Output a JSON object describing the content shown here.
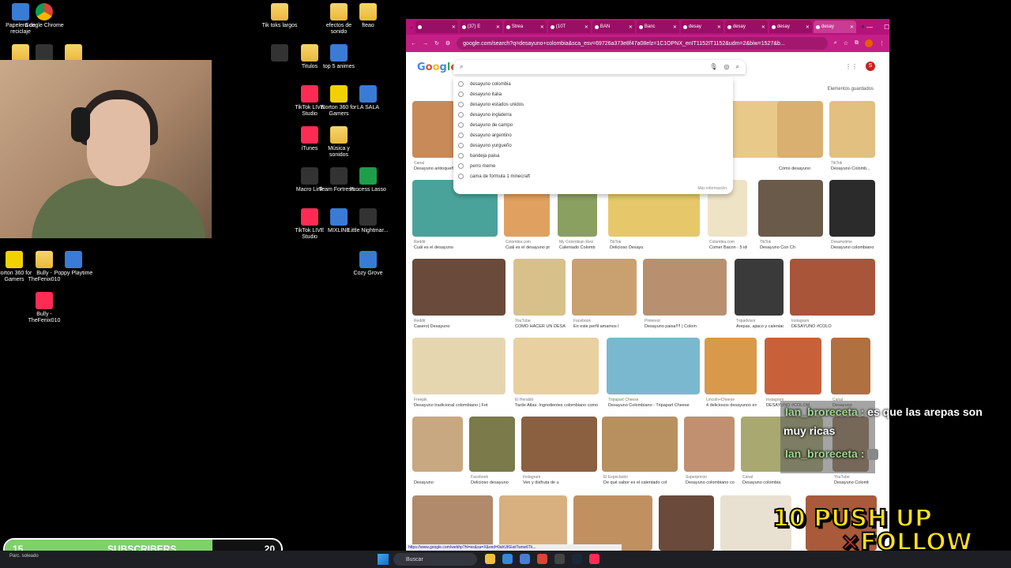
{
  "desktop": {
    "icons": [
      {
        "label": "Papelera de reciclaje",
        "icon": "recycle-bin-icon",
        "kind": "app-blue"
      },
      {
        "label": "Google Chrome",
        "icon": "chrome-icon",
        "kind": "app-chrome"
      },
      {
        "label": "Tik toks largos",
        "icon": "folder-icon",
        "kind": "folder"
      },
      {
        "label": "efectos de sonido",
        "icon": "folder-icon",
        "kind": "folder"
      },
      {
        "label": "fteao",
        "icon": "folder-icon",
        "kind": "folder"
      },
      {
        "label": "Titulos",
        "icon": "folder-icon",
        "kind": "folder"
      },
      {
        "label": "top 5 animes",
        "icon": "document-icon",
        "kind": "app-blue"
      },
      {
        "label": "TikTok LIVE Studio",
        "icon": "tiktok-icon",
        "kind": "app-tiktok"
      },
      {
        "label": "Norton 360 for Gamers",
        "icon": "norton-icon",
        "kind": "app-norton"
      },
      {
        "label": "LA SALA",
        "icon": "document-icon",
        "kind": "app-blue"
      },
      {
        "label": "iTunes",
        "icon": "itunes-icon",
        "kind": "app-tiktok"
      },
      {
        "label": "Música y sonidos",
        "icon": "folder-icon",
        "kind": "folder"
      },
      {
        "label": "Macro Link",
        "icon": "macro-link-icon",
        "kind": "app-dark"
      },
      {
        "label": "Team Fortress...",
        "icon": "team-fortress-icon",
        "kind": "app-dark"
      },
      {
        "label": "Process Lasso",
        "icon": "process-lasso-icon",
        "kind": "app-green"
      },
      {
        "label": "TikTok LIVE Studio",
        "icon": "tiktok-icon",
        "kind": "app-tiktok"
      },
      {
        "label": "MIXLINE",
        "icon": "mixline-icon",
        "kind": "app-blue"
      },
      {
        "label": "Little Nightmar...",
        "icon": "little-nightmares-icon",
        "kind": "app-dark"
      },
      {
        "label": "Cozy Grove",
        "icon": "cozy-grove-icon",
        "kind": "app-blue"
      },
      {
        "label": "Norton 360 for Gamers",
        "icon": "norton-icon",
        "kind": "app-norton"
      },
      {
        "label": "Bully - TheFenix010",
        "icon": "folder-icon",
        "kind": "folder"
      },
      {
        "label": "Poppy Playtime",
        "icon": "poppy-playtime-icon",
        "kind": "app-blue"
      },
      {
        "label": "Bully - TheFenix010",
        "icon": "winrar-icon",
        "kind": "app-tiktok"
      }
    ]
  },
  "browser": {
    "tabs": [
      {
        "label": "",
        "active": false
      },
      {
        "label": "(37) E",
        "active": false
      },
      {
        "label": "Strea",
        "active": false
      },
      {
        "label": "(10T",
        "active": false
      },
      {
        "label": "BAN",
        "active": false
      },
      {
        "label": "Banc",
        "active": false
      },
      {
        "label": "desay",
        "active": false
      },
      {
        "label": "desay",
        "active": false
      },
      {
        "label": "desay",
        "active": false
      },
      {
        "label": "desay",
        "active": true
      }
    ],
    "url": "google.com/search?q=desayuno+colombia&sca_esv=69726a373e8f47a08elz=1C1OPNX_enIT1152IT1152&udm=2&biw=1527&b...",
    "status_url": "https://www.google.com/webhp?hl=es&sa=X&ved=0ahUKEwiTwnw6Tk..."
  },
  "google": {
    "logo": [
      "G",
      "o",
      "o",
      "g",
      "l",
      "e"
    ],
    "search_placeholder": "",
    "suggestions": [
      "desayuno colombia",
      "desayuno italia",
      "desayuno estados unidos",
      "desayuno inglaterra",
      "desayuno de campo",
      "desayuno argentino",
      "desayuno yurgueño",
      "bandeja paisa",
      "perro meme",
      "cama de formula 1 minecraft"
    ],
    "more_info": "Más información",
    "safe_search": "Elementos guardados",
    "account_initial": "S",
    "results": [
      {
        "source": "Canal",
        "caption": "Desayuno antioqueño",
        "color": "#c98a5a"
      },
      {
        "source": "",
        "caption": "",
        "color": "#e8c98a"
      },
      {
        "source": "",
        "caption": "Cómo desayuno",
        "color": "#d9b070"
      },
      {
        "source": "TikTok",
        "caption": "Desayuno Colomb...",
        "color": "#e1c080"
      },
      {
        "source": "Reddit",
        "caption": "Cuál es el desayuno",
        "color": "#4aa39a"
      },
      {
        "source": "Colombia.com",
        "caption": "Cuál es el desayuno preferido por los",
        "color": "#e0a060"
      },
      {
        "source": "My Colombian Reci",
        "caption": "Calentado Colomb",
        "color": "#8aa060"
      },
      {
        "source": "TikTok",
        "caption": "Delicioso Desayu",
        "color": "#e6c86a"
      },
      {
        "source": "Colombia.com",
        "caption": "Comer Bacon · 5 ideas de arepas colombia",
        "color": "#efe3c6"
      },
      {
        "source": "TikTok",
        "caption": "Desayuno Con Ch",
        "color": "#6a5a4a"
      },
      {
        "source": "Dreamstime",
        "caption": "Desayuno colombiano típico",
        "color": "#2b2b2b"
      },
      {
        "source": "Reddit",
        "caption": "Casero| Desayuno",
        "color": "#6a4a3a"
      },
      {
        "source": "YouTube",
        "caption": "CÓMO HACER UN DESAYUNO TÍPICO C",
        "color": "#d8c08a"
      },
      {
        "source": "Facebook",
        "caption": "En este perfil amamos l",
        "color": "#c9a070"
      },
      {
        "source": "Pinterest",
        "caption": "Desayuno paisa!!!! | Colom",
        "color": "#b89070"
      },
      {
        "source": "Tripadvisor",
        "caption": "Arepas, ajiaco y calentado: los mejores",
        "color": "#3a3a3a"
      },
      {
        "source": "Instagram",
        "caption": "DESAYUNO #COLO",
        "color": "#a8553a"
      },
      {
        "source": "Freepik",
        "caption": "Desayuno tradicional colombiano | Fot",
        "color": "#e6d6b0"
      },
      {
        "source": "El Heraldo",
        "caption": "Tarde Atlas: Ingredientes colombiano como un",
        "color": "#e8d0a0"
      },
      {
        "source": "Tripapart Cheese",
        "caption": "Desayuno Colombiano - Tripapart Cheese",
        "color": "#7ab8d0"
      },
      {
        "source": "Lincoln+Cheese",
        "caption": "4 deliciosos desayunos en Colombia Lincoln",
        "color": "#d89a4a"
      },
      {
        "source": "Instagram",
        "caption": "DESAYUNO #COLOM",
        "color": "#c8603a"
      },
      {
        "source": "Canal",
        "caption": "Desayuno",
        "color": "#b07040"
      },
      {
        "source": "",
        "caption": "Desayuno",
        "color": "#c8a880"
      },
      {
        "source": "Facebook",
        "caption": "Delicioso desayuno",
        "color": "#7a7a4a"
      },
      {
        "source": "Instagram",
        "caption": "Ven y disfruta de u",
        "color": "#8a6040"
      },
      {
        "source": "El Espectador",
        "caption": "De qué sabor es el calentado col",
        "color": "#b89060"
      },
      {
        "source": "Superprecio",
        "caption": "Desayuno colombiano completo",
        "color": "#c09070"
      },
      {
        "source": "Canal",
        "caption": "Desayuno colombia",
        "color": "#a8a870"
      },
      {
        "source": "YouTube",
        "caption": "Desayuno Colombiano, AREPAS REL",
        "color": "#9a7a5a"
      },
      {
        "source": "Instagram",
        "caption": "No hay desayuno",
        "color": "#b08a6a"
      },
      {
        "source": "",
        "caption": "",
        "color": "#d8b080"
      },
      {
        "source": "",
        "caption": "",
        "color": "#c09060"
      },
      {
        "source": "",
        "caption": "",
        "color": "#6a4a3a"
      },
      {
        "source": "",
        "caption": "",
        "color": "#e8e0d0"
      },
      {
        "source": "",
        "caption": "",
        "color": "#a85a3a"
      },
      {
        "source": "",
        "caption": "",
        "color": "#d0a070"
      }
    ]
  },
  "chat": {
    "lines": [
      {
        "user": "Ian_broreceta :",
        "message": "es que las arepas son"
      },
      {
        "user": "",
        "message": "muy ricas"
      },
      {
        "user": "Ian_broreceta :",
        "message": ""
      }
    ]
  },
  "overlay": {
    "sub_goal": {
      "current": "15",
      "label": "SUBSCRIBERS",
      "target": "20",
      "progress": 0.75
    },
    "goal_line1": "10 PUSH UP",
    "goal_x": "×",
    "goal_line2": "FOLLOW"
  },
  "taskbar": {
    "weather": "Parc. soleado",
    "search_placeholder": "Buscar",
    "apps": [
      "file-explorer-icon",
      "edge-icon",
      "store-icon",
      "chrome-icon",
      "obs-icon",
      "steam-icon",
      "tiktok-icon"
    ],
    "clock": ""
  },
  "colors": {
    "browser_tab_bar": "#b7127a",
    "sub_progress": "#7fd16a",
    "goal_text": "#ffe01b"
  }
}
